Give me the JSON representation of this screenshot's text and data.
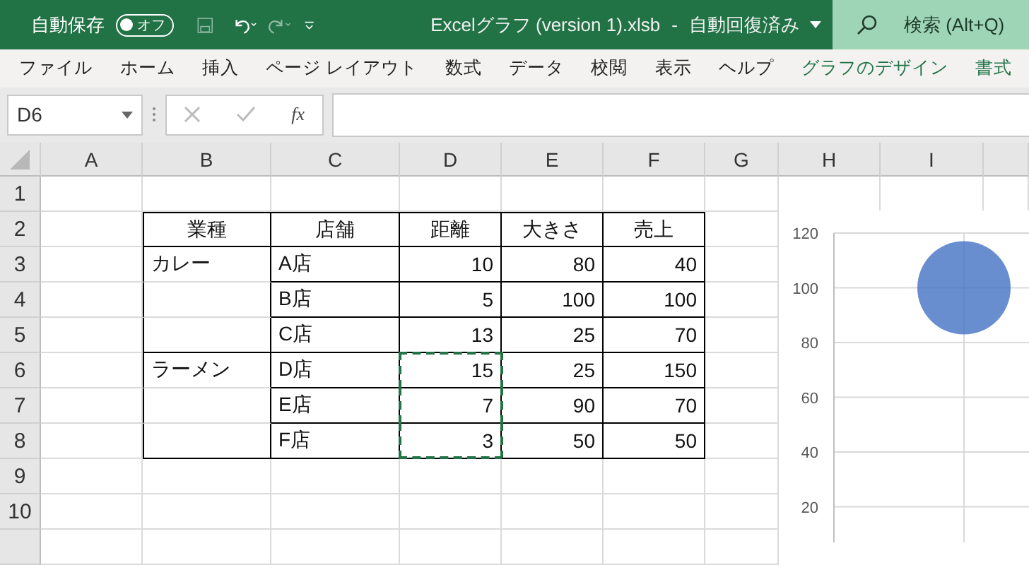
{
  "title_bar": {
    "autosave_label": "自動保存",
    "autosave_toggle": {
      "label": "オフ",
      "on": false
    },
    "file_title": "Excelグラフ (version 1).xlsb",
    "separator": "-",
    "save_status": "自動回復済み",
    "search": {
      "placeholder": "検索 (Alt+Q)"
    }
  },
  "ribbon_tabs": [
    {
      "label": "ファイル",
      "contextual": false
    },
    {
      "label": "ホーム",
      "contextual": false
    },
    {
      "label": "挿入",
      "contextual": false
    },
    {
      "label": "ページ レイアウト",
      "contextual": false
    },
    {
      "label": "数式",
      "contextual": false
    },
    {
      "label": "データ",
      "contextual": false
    },
    {
      "label": "校閲",
      "contextual": false
    },
    {
      "label": "表示",
      "contextual": false
    },
    {
      "label": "ヘルプ",
      "contextual": false
    },
    {
      "label": "グラフのデザイン",
      "contextual": true
    },
    {
      "label": "書式",
      "contextual": true
    }
  ],
  "formula_bar": {
    "name_box": "D6",
    "function_label": "fx"
  },
  "sheet": {
    "columns": [
      "A",
      "B",
      "C",
      "D",
      "E",
      "F",
      "G",
      "H",
      "I"
    ],
    "row_numbers": [
      "1",
      "2",
      "3",
      "4",
      "5",
      "6",
      "7",
      "8",
      "9",
      "10"
    ],
    "table": {
      "header": [
        "業種",
        "店舗",
        "距離",
        "大きさ",
        "売上"
      ],
      "rows": [
        {
          "category": "カレー",
          "shop": "A店",
          "distance": "10",
          "size": "80",
          "sales": "40",
          "in_selection": false
        },
        {
          "shop": "B店",
          "distance": "5",
          "size": "100",
          "sales": "100",
          "in_selection": false
        },
        {
          "shop": "C店",
          "distance": "13",
          "size": "25",
          "sales": "70",
          "in_selection": false
        },
        {
          "category": "ラーメン",
          "shop": "D店",
          "distance": "15",
          "size": "25",
          "sales": "150",
          "in_selection": true
        },
        {
          "shop": "E店",
          "distance": "7",
          "size": "90",
          "sales": "70",
          "in_selection": true
        },
        {
          "shop": "F店",
          "distance": "3",
          "size": "50",
          "sales": "50",
          "in_selection": true
        }
      ]
    }
  },
  "chart": {
    "chart_data": {
      "type": "scatter",
      "grid": true,
      "ylim": [
        0,
        120
      ],
      "yticks": [
        20,
        40,
        60,
        80,
        100,
        120
      ],
      "series": [
        {
          "color": "#4472c4",
          "values": [
            100
          ]
        }
      ]
    }
  }
}
